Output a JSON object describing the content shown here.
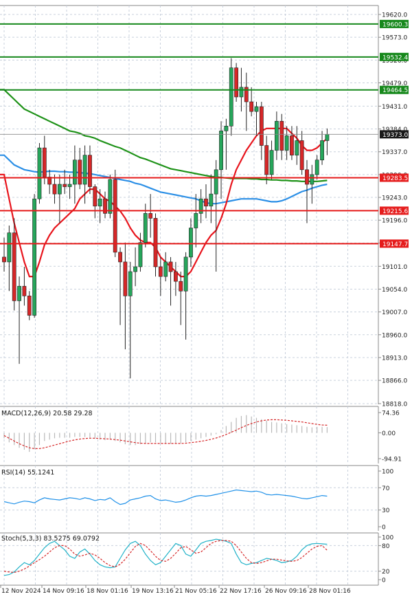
{
  "colors": {
    "bull": "#26a65b",
    "bear": "#d62728",
    "ema_fast": "#e8141c",
    "sma_slow": "#1e9218",
    "ema_mid": "#2b8fe6",
    "level_green": "#16881b",
    "level_red": "#e51c1c",
    "current_price": "#1a1a1a",
    "grid": "#c8d0dc",
    "macd_signal": "#d62728",
    "histogram": "#b8b8b8",
    "rsi": "#1e90e8",
    "stoch_main": "#20b2c8",
    "stoch_signal": "#d62728"
  },
  "chart_data": [
    {
      "type": "candlestick",
      "price_ticks": [
        "19620.0",
        "19573.0",
        "19526.0",
        "19479.0",
        "19431.0",
        "19384.0",
        "19337.0",
        "19290.0",
        "19243.0",
        "19196.0",
        "19149.0",
        "19101.0",
        "19054.0",
        "19007.0",
        "18960.0",
        "18913.0",
        "18866.0",
        "18818.0"
      ],
      "ylim": [
        18818,
        19620
      ],
      "x_labels": [
        "12 Nov 2024",
        "14 Nov 09:16",
        "18 Nov 01:16",
        "19 Nov 13:16",
        "21 Nov 05:16",
        "22 Nov 17:16",
        "26 Nov 09:16",
        "28 Nov 01:16"
      ],
      "current_price": {
        "value": 19373.0,
        "label": "19373.0"
      },
      "levels": [
        {
          "value": 19600.3,
          "label": "19600.3",
          "color": "green"
        },
        {
          "value": 19532.4,
          "label": "19532.4",
          "color": "green"
        },
        {
          "value": 19464.5,
          "label": "19464.5",
          "color": "green"
        },
        {
          "value": 19283.5,
          "label": "19283.5",
          "color": "red"
        },
        {
          "value": 19215.6,
          "label": "19215.6",
          "color": "red"
        },
        {
          "value": 19147.7,
          "label": "19147.7",
          "color": "red"
        }
      ],
      "candles": [
        [
          19120,
          19160,
          19090,
          19110
        ],
        [
          19110,
          19185,
          19050,
          19170
        ],
        [
          19170,
          19200,
          19010,
          19030
        ],
        [
          19030,
          19080,
          18900,
          19060
        ],
        [
          19060,
          19100,
          19020,
          19040
        ],
        [
          19040,
          19050,
          18990,
          19000
        ],
        [
          19000,
          19250,
          18995,
          19240
        ],
        [
          19240,
          19355,
          19230,
          19345
        ],
        [
          19345,
          19370,
          19270,
          19285
        ],
        [
          19285,
          19300,
          19250,
          19270
        ],
        [
          19270,
          19290,
          19230,
          19250
        ],
        [
          19250,
          19290,
          19190,
          19270
        ],
        [
          19270,
          19300,
          19250,
          19265
        ],
        [
          19265,
          19290,
          19240,
          19270
        ],
        [
          19270,
          19350,
          19230,
          19320
        ],
        [
          19320,
          19345,
          19260,
          19270
        ],
        [
          19270,
          19350,
          19230,
          19330
        ],
        [
          19330,
          19350,
          19250,
          19265
        ],
        [
          19265,
          19270,
          19200,
          19225
        ],
        [
          19225,
          19260,
          19190,
          19240
        ],
        [
          19240,
          19255,
          19200,
          19210
        ],
        [
          19210,
          19290,
          19200,
          19280
        ],
        [
          19280,
          19300,
          19120,
          19130
        ],
        [
          19130,
          19140,
          18980,
          19110
        ],
        [
          19110,
          19150,
          18930,
          19040
        ],
        [
          19040,
          19110,
          18870,
          19090
        ],
        [
          19090,
          19140,
          19060,
          19100
        ],
        [
          19100,
          19170,
          19090,
          19150
        ],
        [
          19150,
          19230,
          19140,
          19210
        ],
        [
          19210,
          19250,
          19160,
          19200
        ],
        [
          19200,
          19210,
          19080,
          19100
        ],
        [
          19100,
          19120,
          19040,
          19080
        ],
        [
          19080,
          19130,
          19070,
          19110
        ],
        [
          19110,
          19120,
          19020,
          19090
        ],
        [
          19090,
          19110,
          19040,
          19070
        ],
        [
          19070,
          19090,
          18980,
          19050
        ],
        [
          19050,
          19130,
          18950,
          19120
        ],
        [
          19120,
          19200,
          19100,
          19180
        ],
        [
          19180,
          19250,
          19140,
          19210
        ],
        [
          19210,
          19260,
          19190,
          19240
        ],
        [
          19240,
          19270,
          19200,
          19225
        ],
        [
          19225,
          19290,
          19190,
          19250
        ],
        [
          19250,
          19320,
          19090,
          19300
        ],
        [
          19300,
          19400,
          19240,
          19380
        ],
        [
          19380,
          19405,
          19300,
          19390
        ],
        [
          19390,
          19530,
          19370,
          19510
        ],
        [
          19510,
          19520,
          19440,
          19450
        ],
        [
          19450,
          19510,
          19420,
          19470
        ],
        [
          19470,
          19500,
          19380,
          19440
        ],
        [
          19440,
          19470,
          19410,
          19420
        ],
        [
          19420,
          19440,
          19370,
          19430
        ],
        [
          19430,
          19440,
          19320,
          19350
        ],
        [
          19350,
          19370,
          19270,
          19290
        ],
        [
          19290,
          19360,
          19280,
          19340
        ],
        [
          19340,
          19420,
          19320,
          19400
        ],
        [
          19400,
          19415,
          19320,
          19340
        ],
        [
          19340,
          19390,
          19320,
          19370
        ],
        [
          19370,
          19390,
          19320,
          19330
        ],
        [
          19330,
          19390,
          19310,
          19360
        ],
        [
          19360,
          19380,
          19290,
          19300
        ],
        [
          19300,
          19320,
          19190,
          19270
        ],
        [
          19270,
          19310,
          19230,
          19290
        ],
        [
          19290,
          19330,
          19280,
          19320
        ],
        [
          19320,
          19380,
          19310,
          19360
        ],
        [
          19360,
          19385,
          19330,
          19373
        ]
      ],
      "ema_fast": [
        19290,
        19240,
        19190,
        19150,
        19110,
        19080,
        19080,
        19110,
        19145,
        19165,
        19180,
        19190,
        19200,
        19210,
        19220,
        19240,
        19250,
        19260,
        19260,
        19250,
        19240,
        19235,
        19225,
        19215,
        19200,
        19180,
        19165,
        19155,
        19150,
        19150,
        19140,
        19120,
        19110,
        19100,
        19090,
        19080,
        19080,
        19090,
        19110,
        19130,
        19150,
        19165,
        19175,
        19200,
        19230,
        19270,
        19300,
        19320,
        19340,
        19355,
        19370,
        19380,
        19385,
        19385,
        19385,
        19385,
        19385,
        19375,
        19365,
        19350,
        19340,
        19340,
        19345,
        19355,
        19365
      ],
      "sma_slow": [
        19465,
        19455,
        19445,
        19435,
        19425,
        19420,
        19415,
        19410,
        19405,
        19400,
        19395,
        19390,
        19385,
        19380,
        19378,
        19375,
        19370,
        19368,
        19365,
        19360,
        19356,
        19352,
        19348,
        19345,
        19340,
        19335,
        19330,
        19325,
        19322,
        19318,
        19314,
        19310,
        19306,
        19302,
        19300,
        19298,
        19296,
        19294,
        19292,
        19290,
        19288,
        19286,
        19285,
        19284,
        19283,
        19282,
        19282,
        19282,
        19282,
        19281,
        19281,
        19280,
        19280,
        19279,
        19279,
        19278,
        19278,
        19277,
        19277,
        19276,
        19276,
        19276,
        19276,
        19277,
        19278
      ],
      "ema_mid": [
        19330,
        19320,
        19310,
        19305,
        19300,
        19298,
        19296,
        19295,
        19296,
        19297,
        19297,
        19296,
        19296,
        19295,
        19295,
        19294,
        19293,
        19292,
        19290,
        19288,
        19286,
        19284,
        19282,
        19280,
        19278,
        19276,
        19272,
        19270,
        19266,
        19262,
        19258,
        19254,
        19252,
        19250,
        19248,
        19246,
        19244,
        19242,
        19240,
        19236,
        19232,
        19230,
        19230,
        19232,
        19234,
        19236,
        19238,
        19240,
        19240,
        19240,
        19240,
        19238,
        19236,
        19234,
        19234,
        19236,
        19240,
        19245,
        19250,
        19255,
        19258,
        19262,
        19265,
        19268,
        19270
      ]
    },
    {
      "type": "macd",
      "title": "MACD(12,26,9) 20.58 29.28",
      "ticks": [
        "74.36",
        "0.00",
        "-94.91"
      ],
      "ylim": [
        -94.91,
        74.36
      ],
      "histogram": [
        -20,
        -35,
        -45,
        -55,
        -62,
        -70,
        -60,
        -45,
        -30,
        -25,
        -20,
        -18,
        -18,
        -18,
        -15,
        -15,
        -15,
        -18,
        -22,
        -25,
        -27,
        -25,
        -30,
        -35,
        -42,
        -45,
        -45,
        -42,
        -38,
        -35,
        -35,
        -38,
        -40,
        -40,
        -40,
        -38,
        -35,
        -30,
        -25,
        -20,
        -15,
        -10,
        -5,
        10,
        25,
        40,
        55,
        62,
        65,
        60,
        55,
        50,
        45,
        40,
        38,
        35,
        32,
        30,
        28,
        25,
        22,
        20,
        22,
        22,
        21
      ],
      "signal": [
        -10,
        -20,
        -30,
        -40,
        -48,
        -55,
        -58,
        -58,
        -55,
        -50,
        -45,
        -40,
        -35,
        -30,
        -26,
        -23,
        -21,
        -20,
        -20,
        -21,
        -22,
        -23,
        -25,
        -27,
        -30,
        -33,
        -36,
        -38,
        -39,
        -39,
        -39,
        -39,
        -39,
        -39,
        -39,
        -39,
        -38,
        -36,
        -34,
        -31,
        -28,
        -24,
        -19,
        -13,
        -6,
        2,
        10,
        19,
        27,
        34,
        40,
        44,
        47,
        48,
        48,
        47,
        46,
        44,
        42,
        40,
        37,
        34,
        31,
        29,
        28
      ]
    },
    {
      "type": "rsi",
      "title": "RSI(14) 55.1241",
      "ticks": [
        "100",
        "70",
        "30",
        "0"
      ],
      "ylim": [
        0,
        100
      ],
      "values": [
        45,
        43,
        41,
        44,
        46,
        45,
        43,
        48,
        52,
        50,
        49,
        48,
        50,
        52,
        51,
        49,
        52,
        50,
        47,
        49,
        48,
        52,
        45,
        40,
        42,
        48,
        50,
        52,
        55,
        56,
        50,
        47,
        48,
        46,
        44,
        45,
        48,
        52,
        55,
        56,
        55,
        56,
        58,
        60,
        62,
        64,
        66,
        65,
        64,
        63,
        64,
        62,
        58,
        57,
        58,
        57,
        56,
        55,
        53,
        51,
        50,
        52,
        54,
        56,
        55
      ]
    },
    {
      "type": "stochastic",
      "title": "Stoch(5,3,3) 83.5275 69.0792",
      "ticks": [
        "100",
        "80",
        "20",
        "0"
      ],
      "ylim": [
        0,
        100
      ],
      "main": [
        10,
        12,
        18,
        30,
        40,
        35,
        45,
        60,
        75,
        85,
        90,
        80,
        70,
        55,
        50,
        65,
        72,
        60,
        45,
        35,
        30,
        28,
        30,
        50,
        70,
        85,
        90,
        80,
        60,
        45,
        35,
        40,
        55,
        70,
        85,
        80,
        60,
        55,
        70,
        85,
        90,
        92,
        95,
        93,
        90,
        85,
        60,
        40,
        35,
        38,
        40,
        45,
        50,
        48,
        45,
        40,
        42,
        45,
        55,
        70,
        80,
        84,
        85,
        84,
        83
      ],
      "signal": [
        20,
        18,
        17,
        20,
        25,
        32,
        40,
        47,
        55,
        65,
        75,
        80,
        80,
        72,
        60,
        55,
        58,
        62,
        58,
        50,
        40,
        33,
        30,
        36,
        48,
        63,
        78,
        85,
        80,
        68,
        55,
        45,
        43,
        50,
        62,
        75,
        78,
        70,
        62,
        65,
        75,
        85,
        90,
        92,
        92,
        90,
        80,
        65,
        50,
        40,
        38,
        40,
        44,
        48,
        48,
        46,
        44,
        43,
        45,
        52,
        62,
        72,
        78,
        80,
        69
      ]
    }
  ]
}
